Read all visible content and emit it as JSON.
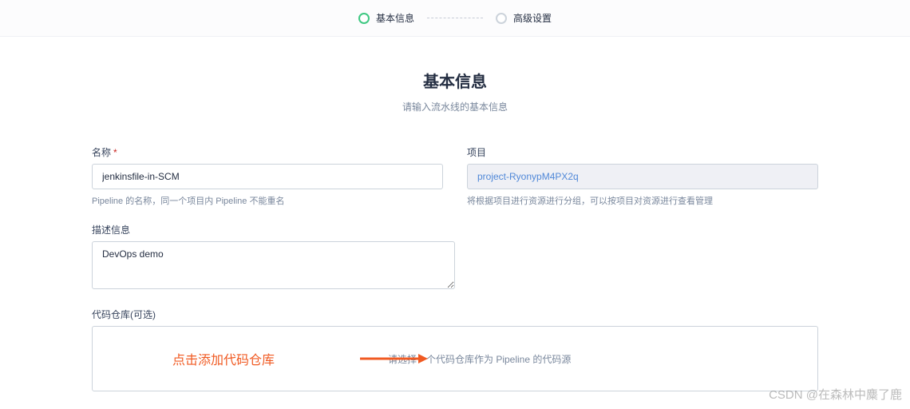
{
  "steps": {
    "step1": "基本信息",
    "step2": "高级设置"
  },
  "header": {
    "title": "基本信息",
    "subtitle": "请输入流水线的基本信息"
  },
  "form": {
    "name": {
      "label": "名称",
      "value": "jenkinsfile-in-SCM",
      "hint": "Pipeline 的名称，同一个项目内 Pipeline 不能重名"
    },
    "project": {
      "label": "项目",
      "value": "project-RyonypM4PX2q",
      "hint": "将根据项目进行资源进行分组，可以按项目对资源进行查看管理"
    },
    "description": {
      "label": "描述信息",
      "value": "DevOps demo"
    },
    "repo": {
      "label": "代码仓库(可选)",
      "annotation": "点击添加代码仓库",
      "placeholder": "请选择一个代码仓库作为 Pipeline 的代码源"
    }
  },
  "watermark": "CSDN @在森林中麋了鹿"
}
